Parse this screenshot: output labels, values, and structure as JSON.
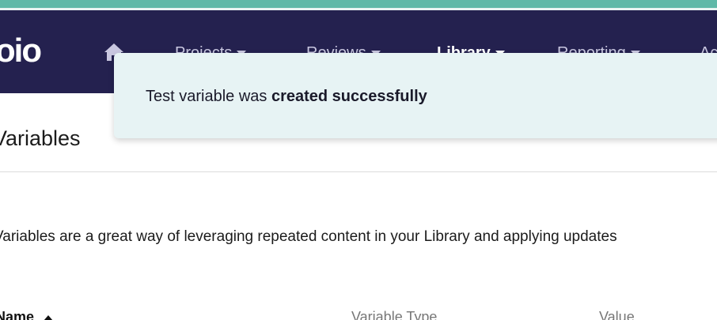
{
  "brand": {
    "logo_text": "oio"
  },
  "nav": {
    "items": [
      {
        "label": "Projects",
        "active": false
      },
      {
        "label": "Reviews",
        "active": false
      },
      {
        "label": "Library",
        "active": true
      },
      {
        "label": "Reporting",
        "active": false
      },
      {
        "label": "Ac",
        "active": false
      }
    ]
  },
  "page": {
    "title": "Variables",
    "description": "Variables are a great way of leveraging repeated content in your Library and applying updates"
  },
  "table": {
    "columns": [
      "Name",
      "Variable Type",
      "Value"
    ]
  },
  "toast": {
    "text_prefix": "Test variable was ",
    "text_bold": "created successfully"
  },
  "colors": {
    "navbar": "#24214f",
    "accent_stripe": "#5fb9a8",
    "toast_bg": "#e7f3f4"
  },
  "icons": {
    "home": "home-icon",
    "nav_caret": "caret-down-icon",
    "sort": "sort-up-icon"
  }
}
